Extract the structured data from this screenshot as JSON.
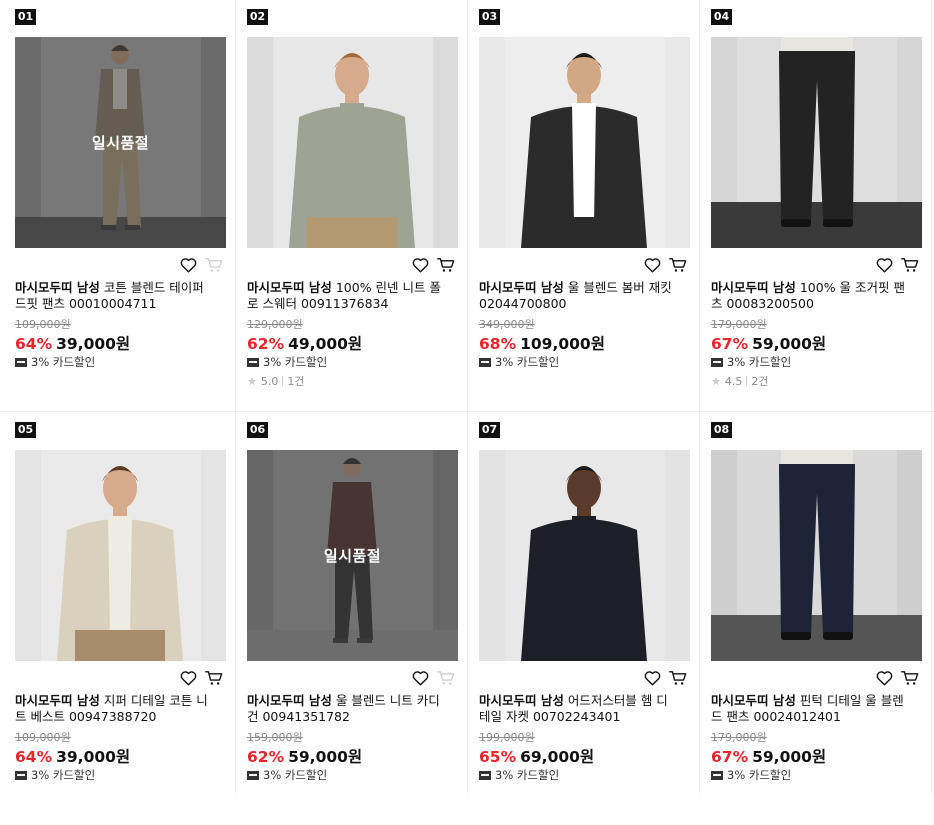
{
  "sold_out_label": "일시품절",
  "products": [
    {
      "rank": "01",
      "brand": "마시모두띠 남성",
      "name": "코튼 블렌드 테이퍼드핏 팬츠 00010004711",
      "original_price": "109,000원",
      "discount": "64%",
      "price": "39,000원",
      "benefit": "3% 카드할인",
      "sold_out": true,
      "rating": null,
      "reviews": null
    },
    {
      "rank": "02",
      "brand": "마시모두띠 남성",
      "name": "100% 린넨 니트 폴로 스웨터 00911376834",
      "original_price": "129,000원",
      "discount": "62%",
      "price": "49,000원",
      "benefit": "3% 카드할인",
      "sold_out": false,
      "rating": "5.0",
      "reviews": "1건"
    },
    {
      "rank": "03",
      "brand": "마시모두띠 남성",
      "name": "울 블렌드 봄버 재킷 02044700800",
      "original_price": "349,000원",
      "discount": "68%",
      "price": "109,000원",
      "benefit": "3% 카드할인",
      "sold_out": false,
      "rating": null,
      "reviews": null
    },
    {
      "rank": "04",
      "brand": "마시모두띠 남성",
      "name": "100% 울 조거핏 팬츠 00083200500",
      "original_price": "179,000원",
      "discount": "67%",
      "price": "59,000원",
      "benefit": "3% 카드할인",
      "sold_out": false,
      "rating": "4.5",
      "reviews": "2건"
    },
    {
      "rank": "05",
      "brand": "마시모두띠 남성",
      "name": "지퍼 디테일 코튼 니트 베스트 00947388720",
      "original_price": "109,000원",
      "discount": "64%",
      "price": "39,000원",
      "benefit": "3% 카드할인",
      "sold_out": false,
      "rating": null,
      "reviews": null
    },
    {
      "rank": "06",
      "brand": "마시모두띠 남성",
      "name": "울 블렌드 니트 카디건 00941351782",
      "original_price": "159,000원",
      "discount": "62%",
      "price": "59,000원",
      "benefit": "3% 카드할인",
      "sold_out": true,
      "rating": null,
      "reviews": null
    },
    {
      "rank": "07",
      "brand": "마시모두띠 남성",
      "name": "어드저스터블 헴 디테일 자켓 00702243401",
      "original_price": "199,000원",
      "discount": "65%",
      "price": "69,000원",
      "benefit": "3% 카드할인",
      "sold_out": false,
      "rating": null,
      "reviews": null
    },
    {
      "rank": "08",
      "brand": "마시모두띠 남성",
      "name": "핀턱 디테일 울 블렌드 팬츠 00024012401",
      "original_price": "179,000원",
      "discount": "67%",
      "price": "59,000원",
      "benefit": "3% 카드할인",
      "sold_out": false,
      "rating": null,
      "reviews": null
    }
  ],
  "colors": {
    "discount": "#e8262c",
    "rank_badge": "#111111",
    "strike_price": "#888888"
  },
  "icons": {
    "wishlist": "heart-icon",
    "cart": "cart-icon",
    "card": "card-icon",
    "rating": "star-icon"
  }
}
